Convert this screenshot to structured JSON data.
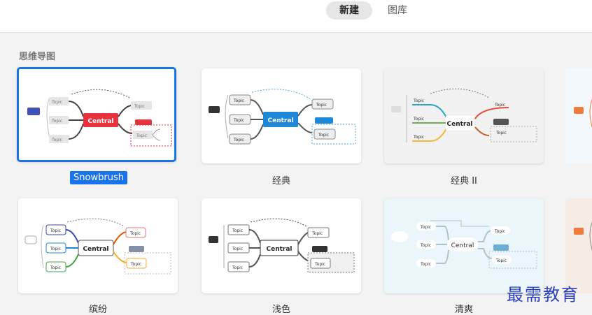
{
  "header": {
    "tabs": [
      {
        "label": "新建"
      },
      {
        "label": "图库"
      }
    ]
  },
  "section": {
    "title": "思维导图"
  },
  "themes": [
    {
      "label": "Snowbrush"
    },
    {
      "label": "经典"
    },
    {
      "label": "经典 II"
    },
    {
      "label": "缤纷"
    },
    {
      "label": "浅色"
    },
    {
      "label": "清爽"
    }
  ],
  "node_text": {
    "central": "Central",
    "topic": "Topic"
  },
  "watermark": "最需教育",
  "colors": {
    "selected_border": "#1a73e8",
    "snowbrush_central": "#e8323c",
    "classic_central": "#1e88d8",
    "classic_ii_bg": "#f1f1f1",
    "fresh_bg": "#eaf6fa"
  }
}
